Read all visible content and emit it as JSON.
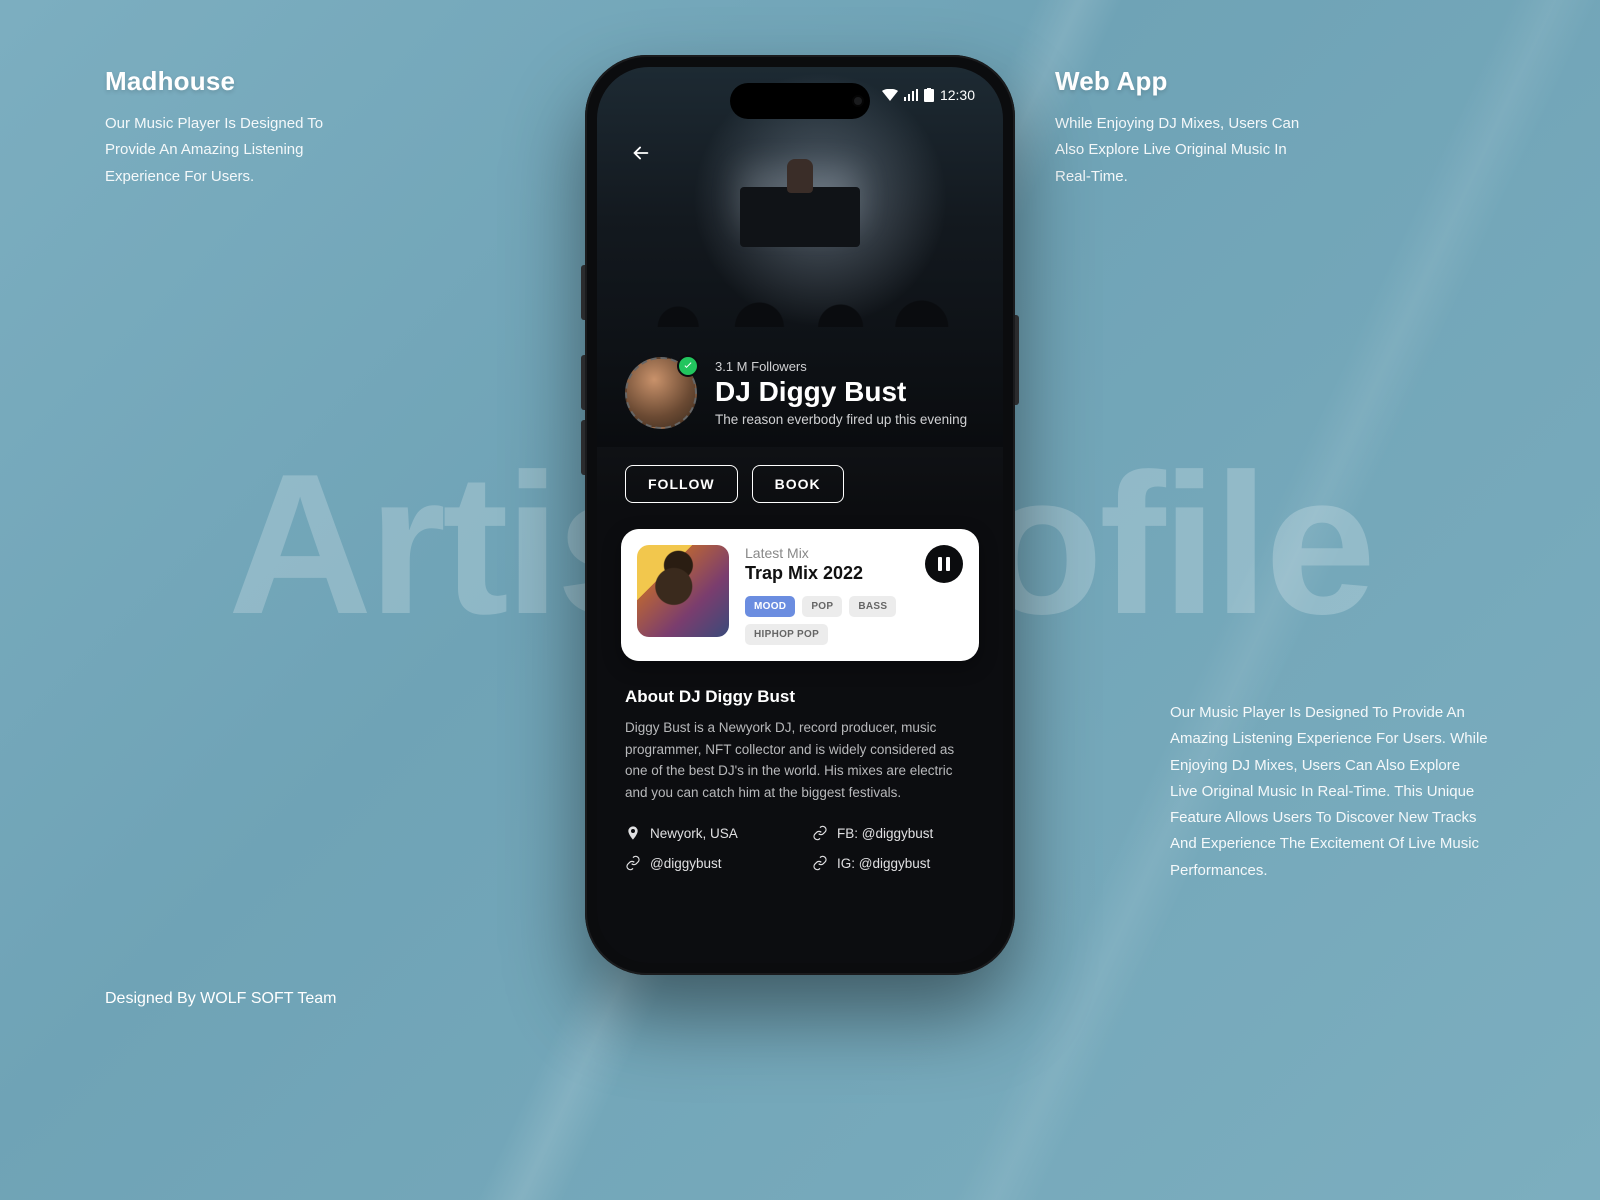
{
  "background_word": "Artist Profile",
  "left_blurb": {
    "title": "Madhouse",
    "body": "Our Music Player Is Designed To Provide An Amazing Listening Experience For Users."
  },
  "right_blurb_top": {
    "title": "Web App",
    "body": "While Enjoying DJ Mixes, Users Can Also Explore Live Original Music In Real-Time."
  },
  "right_blurb_bottom": "Our Music Player Is Designed To Provide An Amazing Listening Experience For Users. While Enjoying DJ Mixes, Users Can Also Explore Live Original Music In Real-Time. This Unique Feature Allows Users To Discover New Tracks And Experience The Excitement Of Live Music Performances.",
  "credit": "Designed By WOLF SOFT Team",
  "status": {
    "time": "12:30"
  },
  "profile": {
    "followers": "3.1 M Followers",
    "name": "DJ Diggy Bust",
    "tagline": "The reason everbody fired up this evening"
  },
  "actions": {
    "follow": "FOLLOW",
    "book": "BOOK"
  },
  "mix": {
    "label": "Latest Mix",
    "title": "Trap Mix 2022",
    "tags": [
      "MOOD",
      "POP",
      "BASS",
      "HIPHOP POP"
    ]
  },
  "about": {
    "heading": "About DJ Diggy Bust",
    "body": "Diggy Bust is a Newyork DJ, record producer, music programmer, NFT collector and is widely considered as one of the best DJ's in the world. His mixes are electric and you can catch him at the biggest festivals."
  },
  "links": {
    "location": "Newyork, USA",
    "fb": "FB: @diggybust",
    "handle": "@diggybust",
    "ig": "IG: @diggybust"
  }
}
